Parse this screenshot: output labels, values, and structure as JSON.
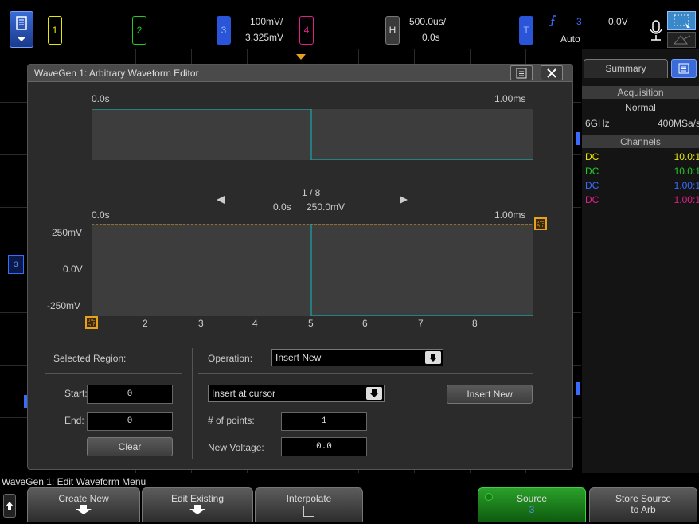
{
  "topbar": {
    "ch1_label": "1",
    "ch2_label": "2",
    "ch3_label": "3",
    "ch3_scale": "100mV/",
    "ch3_offset": "3.325mV",
    "ch4_label": "4",
    "horiz_label": "H",
    "time_scale": "500.0us/",
    "time_delay": "0.0s",
    "trig_label": "T",
    "trig_source": "3",
    "trig_mode": "Auto",
    "trig_level": "0.0V",
    "colors": {
      "ch1": "#e8e800",
      "ch2": "#22cc22",
      "ch3": "#3a6bff",
      "ch4": "#e0208a"
    }
  },
  "editor": {
    "title": "WaveGen 1: Arbitrary Waveform Editor",
    "overview": {
      "t_start": "0.0s",
      "t_end": "1.00ms"
    },
    "nav": {
      "page": "1 / 8",
      "point_time": "0.0s",
      "point_voltage": "250.0mV"
    },
    "detail": {
      "t_start": "0.0s",
      "t_end": "1.00ms",
      "y_labels": [
        "250mV",
        "0.0V",
        "-250mV"
      ],
      "x_ticks": [
        "2",
        "3",
        "4",
        "5",
        "6",
        "7",
        "8"
      ]
    },
    "selected_region": {
      "title": "Selected Region:",
      "start_label": "Start:",
      "start_value": "0",
      "end_label": "End:",
      "end_value": "0",
      "clear_label": "Clear"
    },
    "operation": {
      "label": "Operation:",
      "value": "Insert New",
      "insert_mode": "Insert at cursor",
      "insert_button": "Insert New",
      "points_label": "# of points:",
      "points_value": "1",
      "voltage_label": "New Voltage:",
      "voltage_value": "0.0"
    }
  },
  "right_panel": {
    "tab": "Summary",
    "acq_head": "Acquisition",
    "acq_mode": "Normal",
    "bandwidth": "6GHz",
    "sample_rate": "400MSa/s",
    "channels_head": "Channels",
    "channels": [
      {
        "coupling": "DC",
        "probe": "10.0:1"
      },
      {
        "coupling": "DC",
        "probe": "10.0:1"
      },
      {
        "coupling": "DC",
        "probe": "1.00:1"
      },
      {
        "coupling": "DC",
        "probe": "1.00:1"
      }
    ]
  },
  "menu": {
    "title": "WaveGen 1: Edit Waveform Menu",
    "keys": {
      "create": "Create New",
      "edit": "Edit Existing",
      "interpolate": "Interpolate",
      "source": "Source",
      "source_value": "3",
      "store_line1": "Store Source",
      "store_line2": "to Arb"
    }
  }
}
